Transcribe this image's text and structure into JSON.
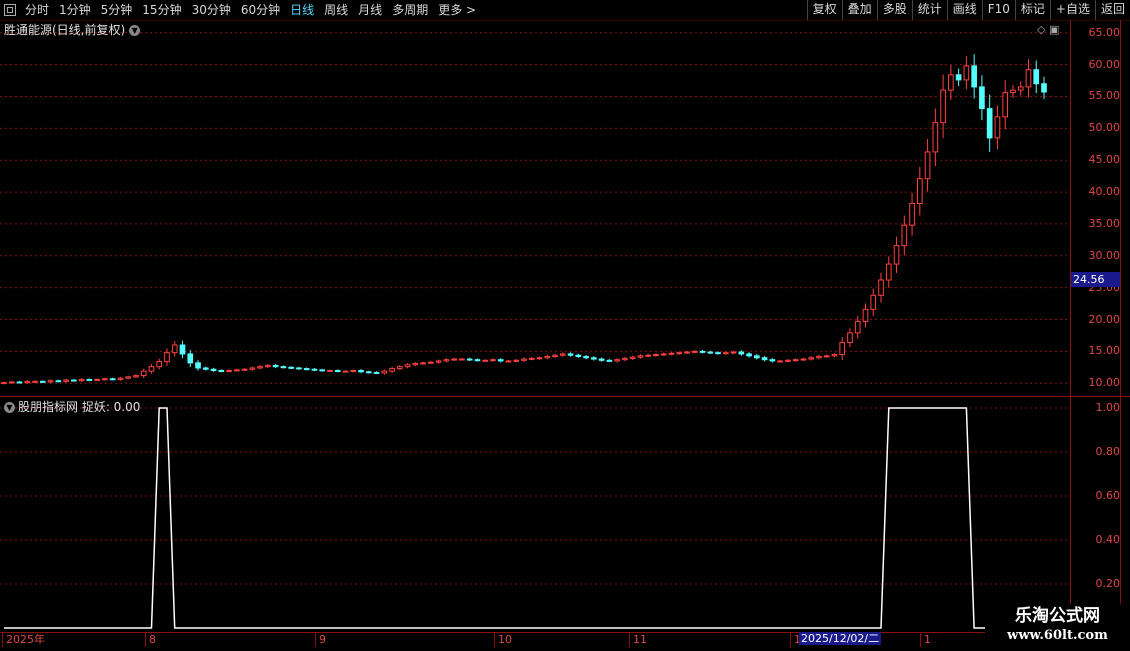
{
  "toolbar": {
    "left_items": [
      "分时",
      "1分钟",
      "5分钟",
      "15分钟",
      "30分钟",
      "60分钟",
      "日线",
      "周线",
      "月线",
      "多周期",
      "更多 >"
    ],
    "active_item": "日线",
    "right_items": [
      "复权",
      "叠加",
      "多股",
      "统计",
      "画线",
      "F10",
      "标记",
      "+自选",
      "返回"
    ]
  },
  "stock_title": "胜通能源(日线,前复权)",
  "indicator_title": "股朋指标网 捉妖: 0.00",
  "current_price_tag": "24.56",
  "price_axis": [
    "65.00",
    "60.00",
    "55.00",
    "50.00",
    "45.00",
    "40.00",
    "35.00",
    "30.00",
    "25.00",
    "20.00",
    "15.00",
    "10.00"
  ],
  "indicator_axis": [
    "1.00",
    "0.80",
    "0.60",
    "0.40",
    "0.20"
  ],
  "date_axis": [
    "2025年",
    "8",
    "9",
    "10",
    "11",
    "1",
    "1"
  ],
  "date_cursor": "2025/12/02/二",
  "watermark": {
    "line1": "乐淘公式网",
    "line2": "www.60lt.com"
  },
  "colors": {
    "up": "#ff4040",
    "down": "#54ffff",
    "grid": "#8b1010",
    "axis_text": "#e04848",
    "line": "#ffffff"
  },
  "chart_data": [
    {
      "type": "candlestick",
      "title": "胜通能源(日线,前复权)",
      "ylim": [
        8,
        67
      ],
      "ohlc_bars": 129,
      "note_series": [
        10.1,
        10.2,
        10.1,
        10.3,
        10.3,
        10.2,
        10.4,
        10.3,
        10.5,
        10.4,
        10.6,
        10.5,
        10.6,
        10.7,
        10.6,
        10.8,
        11.0,
        11.2,
        11.9,
        12.6,
        13.4,
        14.8,
        16.0,
        14.6,
        13.2,
        12.4,
        12.2,
        12.0,
        11.9,
        12.0,
        12.1,
        12.2,
        12.4,
        12.6,
        12.8,
        12.6,
        12.5,
        12.4,
        12.3,
        12.2,
        12.1,
        12.0,
        12.0,
        11.9,
        11.9,
        12.0,
        11.8,
        11.7,
        11.6,
        11.9,
        12.3,
        12.6,
        12.9,
        13.1,
        13.2,
        13.3,
        13.5,
        13.7,
        13.8,
        13.8,
        13.7,
        13.6,
        13.6,
        13.7,
        13.5,
        13.5,
        13.6,
        13.8,
        13.9,
        14.0,
        14.2,
        14.4,
        14.6,
        14.4,
        14.2,
        14.0,
        13.8,
        13.6,
        13.5,
        13.7,
        13.9,
        14.1,
        14.3,
        14.4,
        14.5,
        14.6,
        14.7,
        14.8,
        14.9,
        15.0,
        14.9,
        14.8,
        14.7,
        14.8,
        14.9,
        14.6,
        14.3,
        14.0,
        13.7,
        13.5,
        13.5,
        13.6,
        13.7,
        13.8,
        14.0,
        14.2,
        14.3,
        14.5,
        16.4,
        17.9,
        19.7,
        21.6,
        23.8,
        26.2,
        28.7,
        31.6,
        34.8,
        38.2,
        42.1,
        46.3,
        50.9,
        56.0,
        58.4,
        57.6,
        59.8,
        56.5,
        53.1,
        48.5,
        51.8,
        55.6,
        56.0,
        56.5,
        59.2,
        57.0,
        55.7
      ]
    },
    {
      "type": "line",
      "title": "捉妖",
      "ylim": [
        0,
        1.05
      ],
      "series": [
        {
          "name": "捉妖",
          "values_note": "0 except pulse to 1 near index 20-21 and from index 114 to 124"
        }
      ]
    }
  ]
}
